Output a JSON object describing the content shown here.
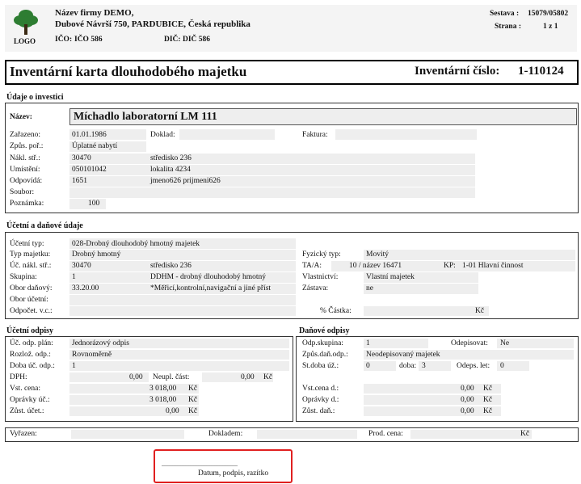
{
  "header": {
    "logo_label": "LOGO",
    "company_name": "Název firmy DEMO,",
    "company_address": "Dubové Návrší 750, PARDUBICE, Česká republika",
    "ico_label": "IČO:",
    "ico_value": "IČO 586",
    "dic_label": "DIČ:",
    "dic_value": "DIČ 586",
    "sestava_label": "Sestava :",
    "sestava_value": "15079/05802",
    "strana_label": "Strana :",
    "strana_value": "1 z 1"
  },
  "title": {
    "text": "Inventární karta dlouhodobého majetku",
    "inv_label": "Inventární číslo:",
    "inv_value": "1-110124"
  },
  "investice": {
    "section": "Údaje o investici",
    "nazev_label": "Název:",
    "nazev_value": "Míchadlo laboratorní LM 111",
    "zarazeno_label": "Zařazeno:",
    "zarazeno_value": "01.01.1986",
    "doklad_label": "Doklad:",
    "faktura_label": "Faktura:",
    "zpus_label": "Způs. poř.:",
    "zpus_value": "Úplatné nabytí",
    "nakl_label": "Nákl. stř.:",
    "nakl_value": "30470",
    "nakl_text": "středisko 236",
    "umisteni_label": "Umístění:",
    "umisteni_value": "050101042",
    "umisteni_text": "lokalita 4234",
    "odpovida_label": "Odpovídá:",
    "odpovida_value": "1651",
    "odpovida_text": "jmeno626 prijmeni626",
    "soubor_label": "Soubor:",
    "poznamka_label": "Poznámka:",
    "poznamka_value": "100"
  },
  "ucetni": {
    "section": "Účetní a daňové údaje",
    "typ_label": "Účetní typ:",
    "typ_value": "028-Drobný dlouhodobý hmotný majetek",
    "typmaj_label": "Typ majetku:",
    "typmaj_value": "Drobný hmotný",
    "fyz_label": "Fyzický typ:",
    "fyz_value": "Movitý",
    "ucnakl_label": "Úč. nákl. stř.:",
    "ucnakl_value": "30470",
    "ucnakl_text": "středisko 236",
    "ta_label": "TA/A:",
    "ta_value": "10 / název 16471",
    "kp_label": "KP:",
    "kp_value": "1-01 Hlavní činnost",
    "skupina_label": "Skupina:",
    "skupina_value": "1",
    "skupina_text": "DDHM - drobný dlouhodobý hmotný",
    "vlast_label": "Vlastnictví:",
    "vlast_value": "Vlastní majetek",
    "obor_label": "Obor daňový:",
    "obor_value": "33.20.00",
    "obor_text": "*Měřicí,kontrolní,navigační a jiné příst",
    "zastava_label": "Zástava:",
    "zastava_value": "ne",
    "oborucet_label": "Obor účetní:",
    "odpocet_label": "Odpočet. v.c.:",
    "castka_label": "% Částka:",
    "castka_unit": "Kč"
  },
  "ucetni_odpisy": {
    "section": "Účetní odpisy",
    "plan_label": "Úč. odp. plán:",
    "plan_value": "Jednorázový odpis",
    "rozloz_label": "Rozlož. odp.:",
    "rozloz_value": "Rovnoměrně",
    "doba_label": "Doba úč. odp.:",
    "doba_value": "1",
    "dph_label": "DPH:",
    "dph_value": "0,00",
    "neupl_label": "Neupl. část:",
    "neupl_value": "0,00",
    "neupl_unit": "Kč",
    "vst_label": "Vst. cena:",
    "vst_value": "3 018,00",
    "vst_unit": "Kč",
    "opr_label": "Oprávky úč.:",
    "opr_value": "3 018,00",
    "opr_unit": "Kč",
    "zust_label": "Zůst. účet.:",
    "zust_value": "0,00",
    "zust_unit": "Kč"
  },
  "danove_odpisy": {
    "section": "Daňové odpisy",
    "skup_label": "Odp.skupina:",
    "skup_value": "1",
    "odepisovat_label": "Odepisovat:",
    "odepisovat_value": "Ne",
    "zpus_label": "Způs.daň.odp.:",
    "zpus_value": "Neodepisovaný majetek",
    "stdoba_label": "St.doba úž.:",
    "stdoba_value": "0",
    "doba_label": "doba:",
    "doba_value": "3",
    "odeps_label": "Odeps. let:",
    "odeps_value": "0",
    "vst_label": "Vst.cena d.:",
    "vst_value": "0,00",
    "vst_unit": "Kč",
    "opr_label": "Oprávky d.:",
    "opr_value": "0,00",
    "opr_unit": "Kč",
    "zust_label": "Zůst. daň.:",
    "zust_value": "0,00",
    "zust_unit": "Kč"
  },
  "vyrazeni": {
    "vyrazen_label": "Vyřazen:",
    "dokladem_label": "Dokladem:",
    "prod_label": "Prod. cena:",
    "prod_unit": "Kč"
  },
  "signature": {
    "dots": "...............................................",
    "label": "Datum, podpis, razítko"
  },
  "colors": {
    "highlight_border": "#e02020",
    "field_bg": "#eeeeee",
    "logo_green": "#2e7d32"
  }
}
